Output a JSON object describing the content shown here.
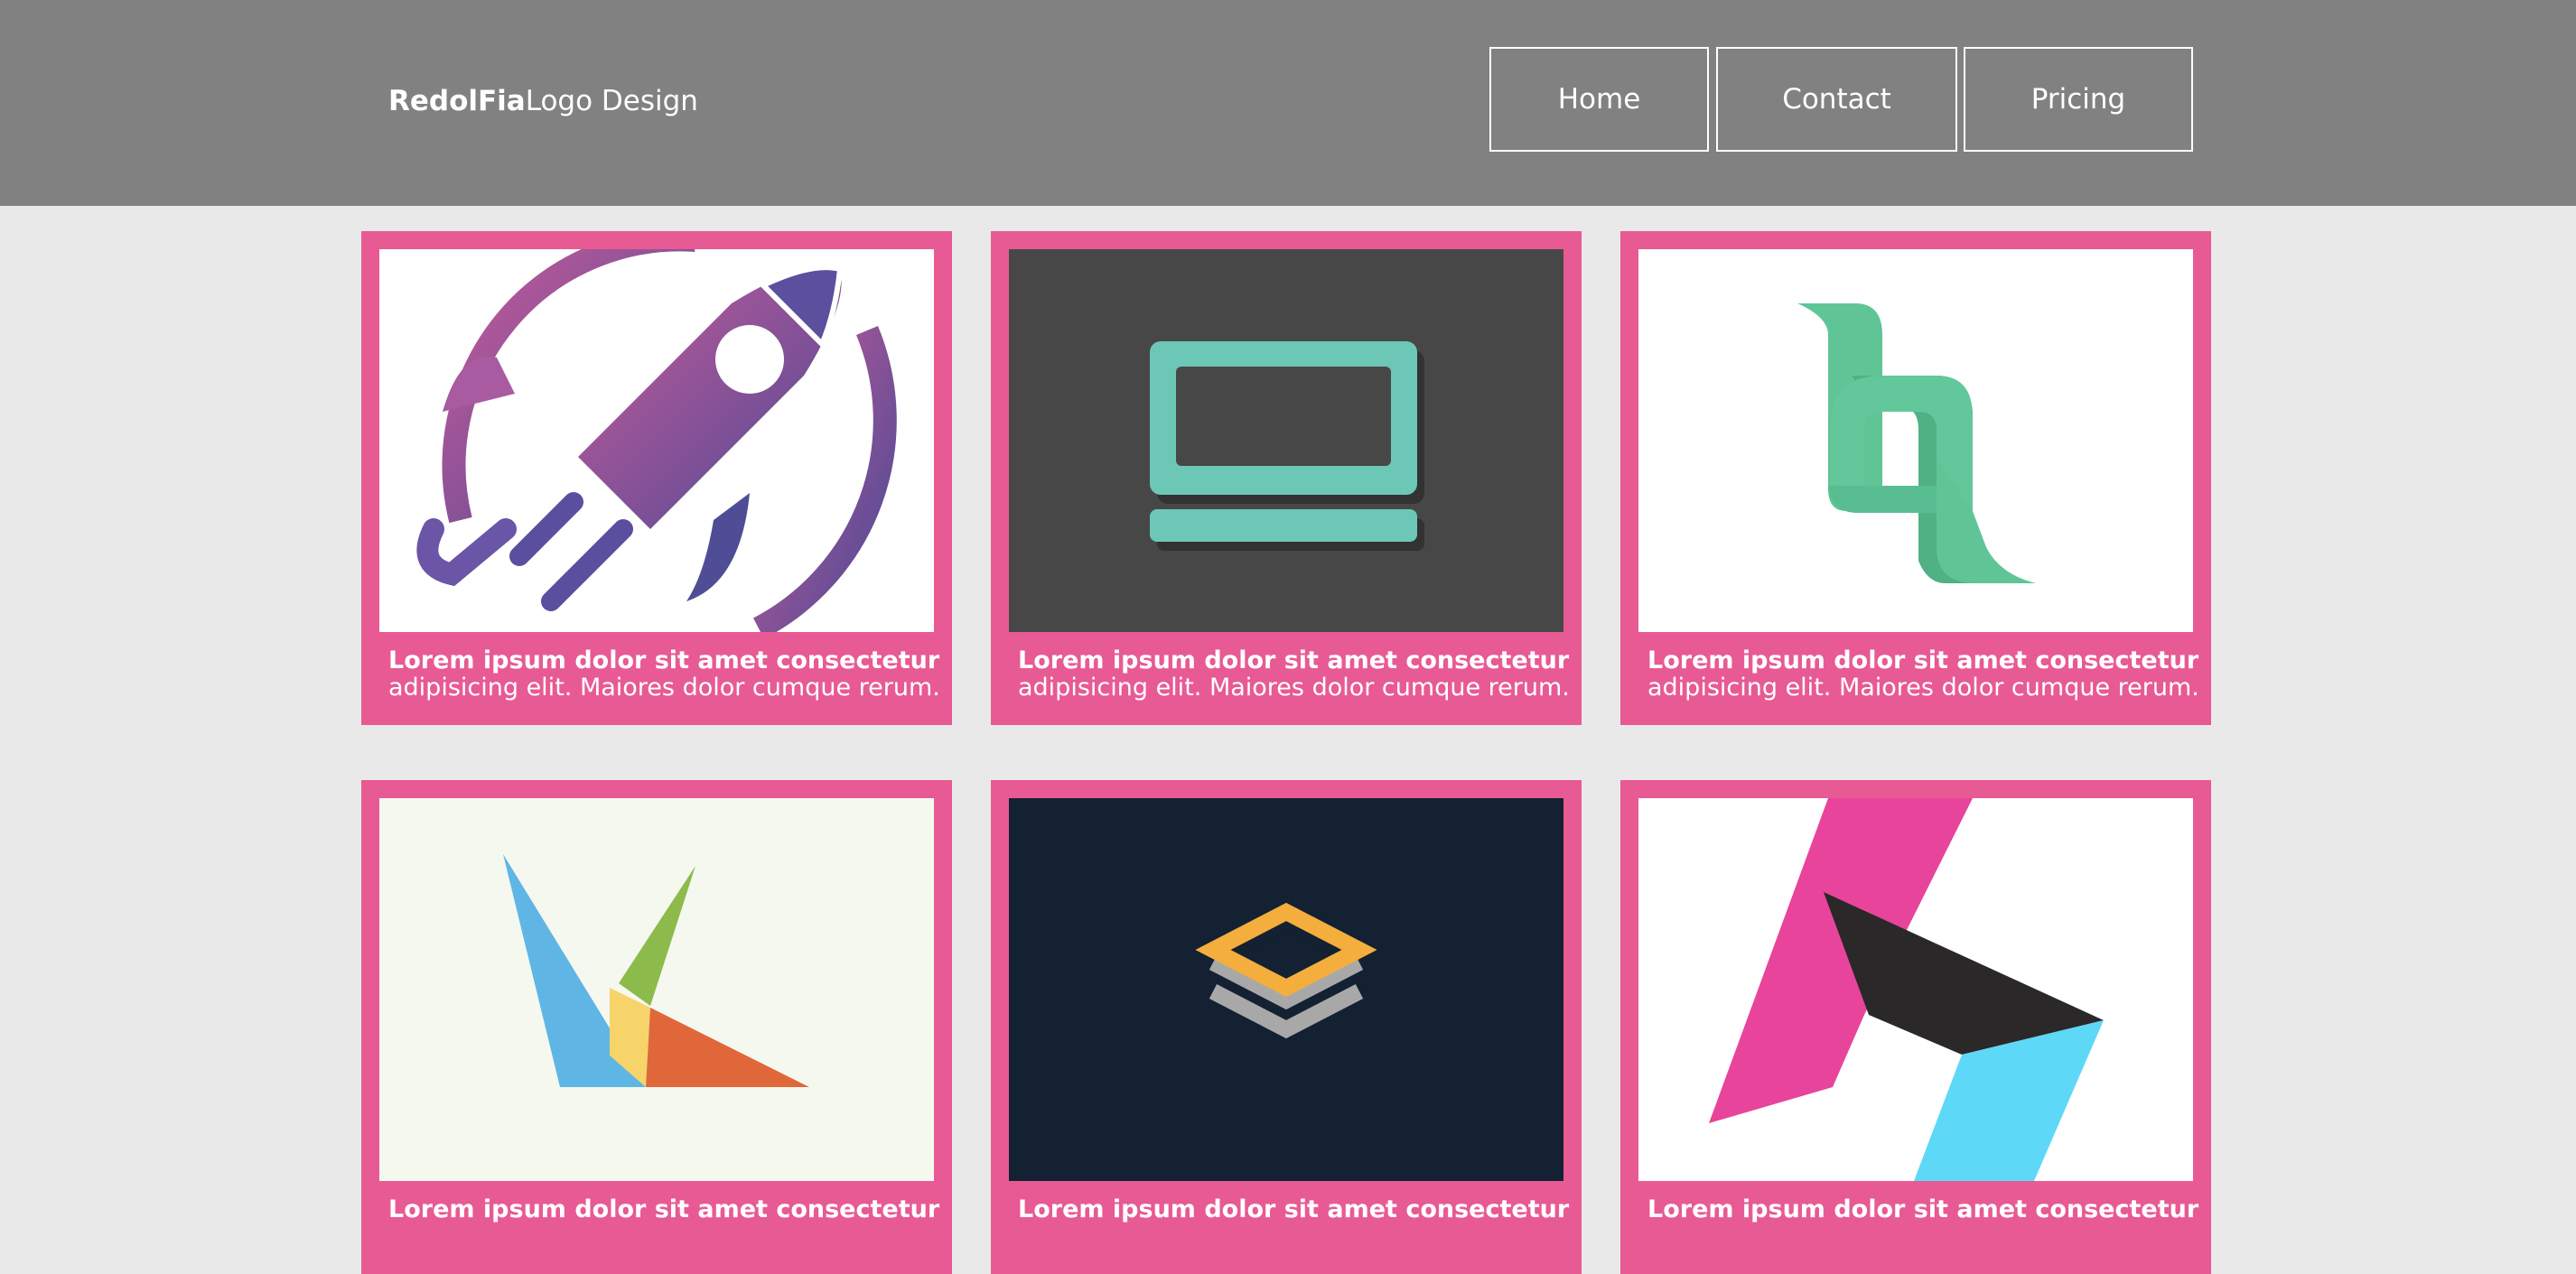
{
  "brand": {
    "name_bold": "RedolFia",
    "name_rest": "Logo Design"
  },
  "nav": {
    "home": "Home",
    "contact": "Contact",
    "pricing": "Pricing"
  },
  "cards": [
    {
      "title": "Lorem ipsum dolor sit amet consectetur",
      "desc": "adipisicing elit. Maiores dolor cumque rerum.",
      "icon": "rocket-logo"
    },
    {
      "title": "Lorem ipsum dolor sit amet consectetur",
      "desc": "adipisicing elit. Maiores dolor cumque rerum.",
      "icon": "laptop-logo"
    },
    {
      "title": "Lorem ipsum dolor sit amet consectetur",
      "desc": "adipisicing elit. Maiores dolor cumque rerum.",
      "icon": "ribbon-letter-logo"
    },
    {
      "title": "Lorem ipsum dolor sit amet consectetur",
      "desc": "",
      "icon": "bird-triangles-logo"
    },
    {
      "title": "Lorem ipsum dolor sit amet consectetur",
      "desc": "",
      "icon": "stacked-chevrons-logo"
    },
    {
      "title": "Lorem ipsum dolor sit amet consectetur",
      "desc": "",
      "icon": "folded-h-logo"
    }
  ],
  "colors": {
    "header": "#818181",
    "background": "#e9e9e9",
    "card": "#e85a93",
    "text": "#ffffff"
  }
}
